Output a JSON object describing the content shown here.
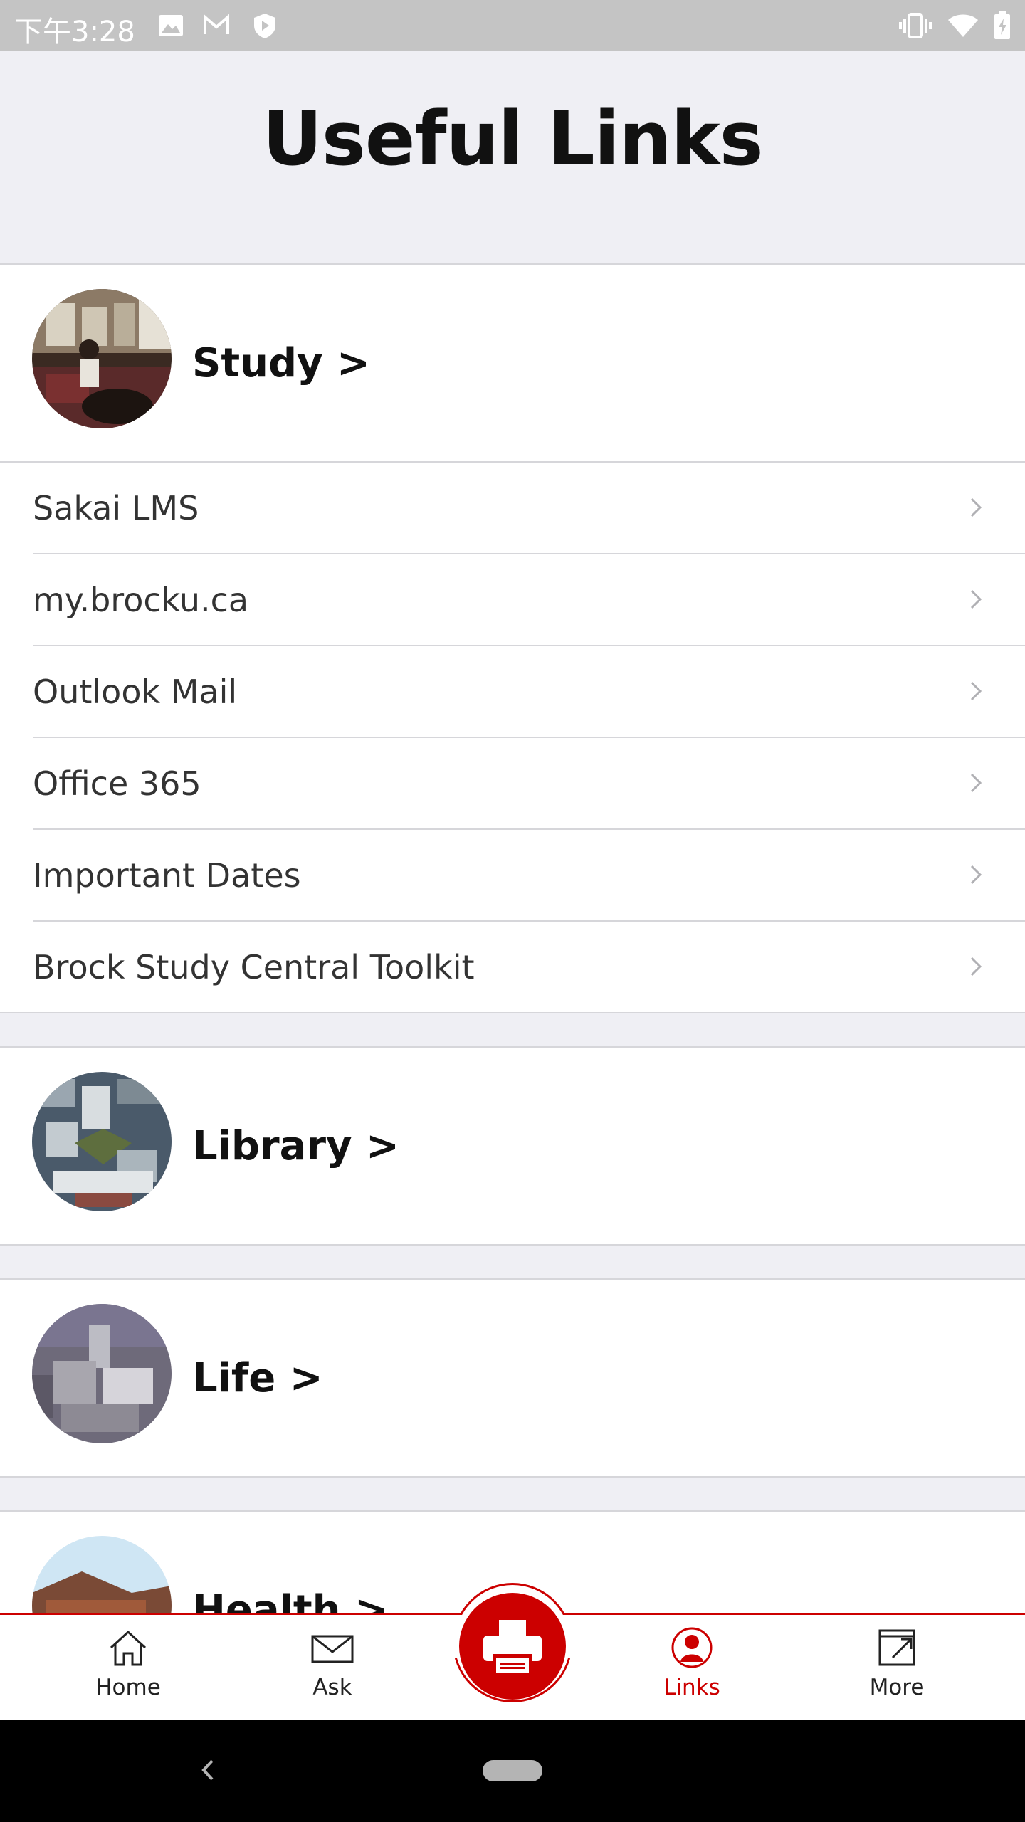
{
  "status_bar": {
    "time": "下午3:28",
    "icons": [
      "image-icon",
      "gmail-icon",
      "shield-icon",
      "vibrate-icon",
      "wifi-icon",
      "battery-icon"
    ]
  },
  "header": {
    "title": "Useful Links"
  },
  "sections": [
    {
      "title": "Study >",
      "links": [
        "Sakai LMS",
        "my.brocku.ca",
        "Outlook Mail",
        "Office 365",
        "Important Dates",
        "Brock Study Central Toolkit"
      ]
    },
    {
      "title": "Library >",
      "links": []
    },
    {
      "title": "Life >",
      "links": []
    },
    {
      "title": "Health >",
      "links": []
    }
  ],
  "tabbar": {
    "tabs": [
      {
        "label": "Home",
        "icon": "home-icon"
      },
      {
        "label": "Ask",
        "icon": "mail-icon"
      },
      {
        "label": "",
        "icon": "printer-icon"
      },
      {
        "label": "Links",
        "icon": "person-icon"
      },
      {
        "label": "More",
        "icon": "external-link-icon"
      }
    ],
    "active": "Links",
    "accent_color": "#cc0000"
  },
  "colors": {
    "background": "#efeff4",
    "accent": "#cc0000",
    "text": "#111111"
  }
}
